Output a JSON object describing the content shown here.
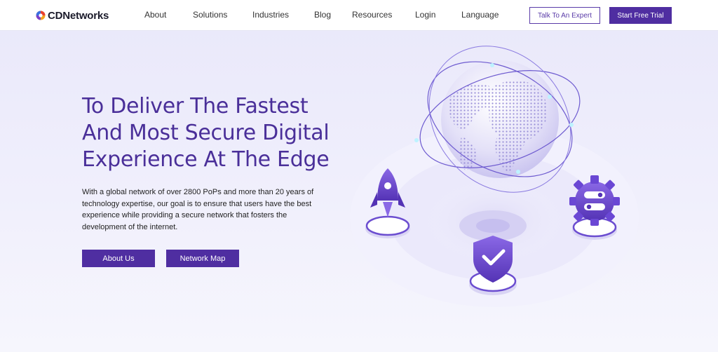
{
  "header": {
    "logo_text": "CDNetworks",
    "nav": [
      "About",
      "Solutions",
      "Industries",
      "Blog",
      "Resources",
      "Login",
      "Language"
    ],
    "talk_button": "Talk To An Expert",
    "trial_button": "Start Free Trial"
  },
  "hero": {
    "headline_lines": [
      "To Deliver The Fastest",
      "And Most Secure Digital",
      "Experience At The Edge"
    ],
    "description": "With a global network of over 2800 PoPs and more than 20 years of technology expertise, our goal is to ensure that users have the best experience while providing a secure network that fosters the development of the internet.",
    "about_button": "About Us",
    "map_button": "Network Map"
  },
  "colors": {
    "brand_purple": "#4f2ea1",
    "headline_purple": "#4a2f99",
    "background": "#ecebfb"
  },
  "illustration_icons": [
    "globe-icon",
    "rocket-icon",
    "shield-check-icon",
    "gear-icon"
  ]
}
